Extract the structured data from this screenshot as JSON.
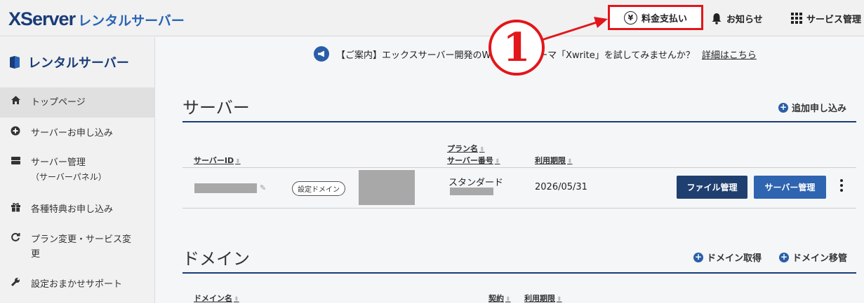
{
  "header": {
    "logo_main": "XServer",
    "logo_sub": "レンタルサーバー",
    "payment": "料金支払い",
    "yen_symbol": "¥",
    "notice": "お知らせ",
    "service": "サービス管理"
  },
  "annotation": {
    "marker": "1",
    "color": "#e2161b"
  },
  "sidebar": {
    "title": "レンタルサーバー",
    "items": [
      {
        "label": "トップページ",
        "icon": "home-icon",
        "active": true
      },
      {
        "label": "サーバーお申し込み",
        "icon": "plus-circle-icon"
      },
      {
        "label": "サーバー管理",
        "sub": "（サーバーパネル）",
        "icon": "server-icon"
      },
      {
        "label": "各種特典お申し込み",
        "icon": "gift-icon"
      },
      {
        "label": "プラン変更・サービス変",
        "sub": "更",
        "icon": "refresh-icon"
      },
      {
        "label": "設定おまかせサポート",
        "icon": "wrench-icon"
      }
    ]
  },
  "announcement": {
    "text": "【ご案内】エックスサーバー開発のWordPressテーマ「Xwrite」を試してみませんか？",
    "link": "詳細はこちら"
  },
  "server_section": {
    "title": "サーバー",
    "add_label": "追加申し込み",
    "columns": {
      "server_id": "サーバーID",
      "plan_name": "プラン名",
      "server_number": "サーバー番号",
      "expiry": "利用期限"
    },
    "row": {
      "tag": "設定ドメイン",
      "plan": "スタンダード",
      "expiry": "2026/05/31",
      "file_button": "ファイル管理",
      "server_button": "サーバー管理"
    }
  },
  "domain_section": {
    "title": "ドメイン",
    "acquire_label": "ドメイン取得",
    "transfer_label": "ドメイン移管",
    "columns": {
      "domain_name": "ドメイン名",
      "contract": "契約",
      "expiry": "利用期限"
    }
  }
}
